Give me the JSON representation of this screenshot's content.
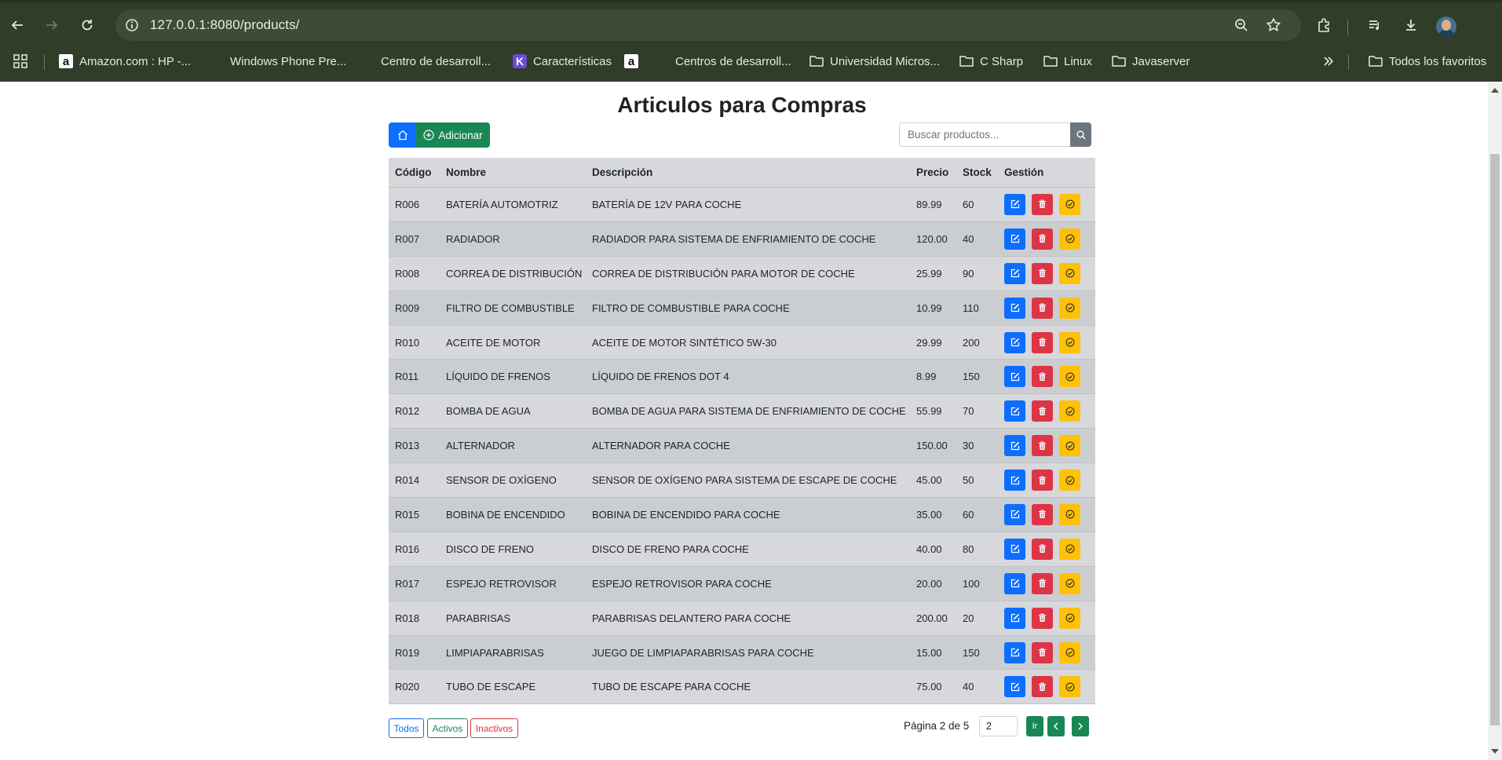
{
  "browser": {
    "url": "127.0.0.1:8080/products/",
    "bookmarks": [
      {
        "label": "Amazon.com : HP -...",
        "icon": "amazon-icon"
      },
      {
        "label": "Windows Phone Pre...",
        "icon": "microsoft-icon"
      },
      {
        "label": "Centro de desarroll...",
        "icon": "microsoft-icon"
      },
      {
        "label": "Características",
        "icon": "k-app-icon"
      },
      {
        "label": "",
        "icon": "amazon-icon"
      },
      {
        "label": "Centros de desarroll...",
        "icon": "microsoft-icon"
      },
      {
        "label": "Universidad Micros...",
        "icon": "folder-icon"
      },
      {
        "label": "C Sharp",
        "icon": "folder-icon"
      },
      {
        "label": "Linux",
        "icon": "folder-icon"
      },
      {
        "label": "Javaserver",
        "icon": "folder-icon"
      }
    ],
    "all_bookmarks": "Todos los favoritos"
  },
  "page": {
    "title": "Articulos para Compras",
    "add_label": "Adicionar",
    "search_placeholder": "Buscar productos...",
    "columns": {
      "code": "Código",
      "name": "Nombre",
      "description": "Descripción",
      "price": "Precio",
      "stock": "Stock",
      "management": "Gestión"
    },
    "rows": [
      {
        "code": "R006",
        "name": "BATERÍA AUTOMOTRIZ",
        "description": "BATERÍA DE 12V PARA COCHE",
        "price": "89.99",
        "stock": "60"
      },
      {
        "code": "R007",
        "name": "RADIADOR",
        "description": "RADIADOR PARA SISTEMA DE ENFRIAMIENTO DE COCHE",
        "price": "120.00",
        "stock": "40"
      },
      {
        "code": "R008",
        "name": "CORREA DE DISTRIBUCIÓN",
        "description": "CORREA DE DISTRIBUCIÓN PARA MOTOR DE COCHE",
        "price": "25.99",
        "stock": "90"
      },
      {
        "code": "R009",
        "name": "FILTRO DE COMBUSTIBLE",
        "description": "FILTRO DE COMBUSTIBLE PARA COCHE",
        "price": "10.99",
        "stock": "110"
      },
      {
        "code": "R010",
        "name": "ACEITE DE MOTOR",
        "description": "ACEITE DE MOTOR SINTÉTICO 5W-30",
        "price": "29.99",
        "stock": "200"
      },
      {
        "code": "R011",
        "name": "LÍQUIDO DE FRENOS",
        "description": "LÍQUIDO DE FRENOS DOT 4",
        "price": "8.99",
        "stock": "150"
      },
      {
        "code": "R012",
        "name": "BOMBA DE AGUA",
        "description": "BOMBA DE AGUA PARA SISTEMA DE ENFRIAMIENTO DE COCHE",
        "price": "55.99",
        "stock": "70"
      },
      {
        "code": "R013",
        "name": "ALTERNADOR",
        "description": "ALTERNADOR PARA COCHE",
        "price": "150.00",
        "stock": "30"
      },
      {
        "code": "R014",
        "name": "SENSOR DE OXÍGENO",
        "description": "SENSOR DE OXÍGENO PARA SISTEMA DE ESCAPE DE COCHE",
        "price": "45.00",
        "stock": "50"
      },
      {
        "code": "R015",
        "name": "BOBINA DE ENCENDIDO",
        "description": "BOBINA DE ENCENDIDO PARA COCHE",
        "price": "35.00",
        "stock": "60"
      },
      {
        "code": "R016",
        "name": "DISCO DE FRENO",
        "description": "DISCO DE FRENO PARA COCHE",
        "price": "40.00",
        "stock": "80"
      },
      {
        "code": "R017",
        "name": "ESPEJO RETROVISOR",
        "description": "ESPEJO RETROVISOR PARA COCHE",
        "price": "20.00",
        "stock": "100"
      },
      {
        "code": "R018",
        "name": "PARABRISAS",
        "description": "PARABRISAS DELANTERO PARA COCHE",
        "price": "200.00",
        "stock": "20"
      },
      {
        "code": "R019",
        "name": "LIMPIAPARABRISAS",
        "description": "JUEGO DE LIMPIAPARABRISAS PARA COCHE",
        "price": "15.00",
        "stock": "150"
      },
      {
        "code": "R020",
        "name": "TUBO DE ESCAPE",
        "description": "TUBO DE ESCAPE PARA COCHE",
        "price": "75.00",
        "stock": "40"
      }
    ],
    "filters": {
      "all": "Todos",
      "active": "Activos",
      "inactive": "Inactivos"
    },
    "pagination": {
      "label": "Página 2 de 5",
      "page_value": "2",
      "go_label": "Ir"
    }
  },
  "colors": {
    "primary": "#0d6efd",
    "success": "#198754",
    "danger": "#dc3545",
    "warning": "#ffc107",
    "secondary": "#6c757d"
  }
}
